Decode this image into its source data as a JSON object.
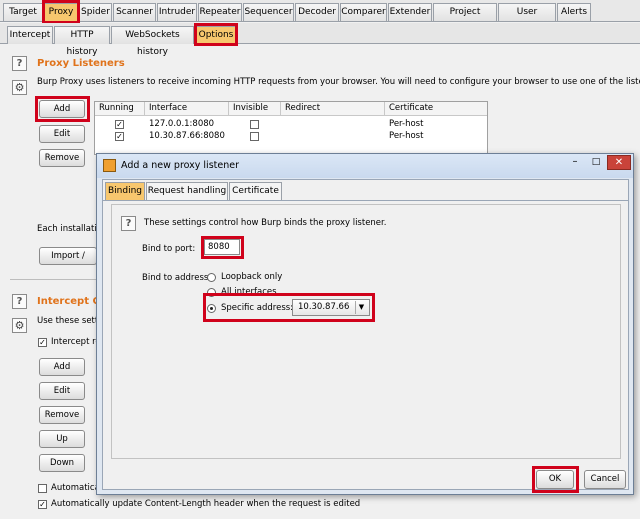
{
  "top_tabs": [
    "Target",
    "Proxy",
    "Spider",
    "Scanner",
    "Intruder",
    "Repeater",
    "Sequencer",
    "Decoder",
    "Comparer",
    "Extender",
    "Project options",
    "User options",
    "Alerts"
  ],
  "sub_tabs": [
    "Intercept",
    "HTTP history",
    "WebSockets history",
    "Options"
  ],
  "proxy_listeners": {
    "title": "Proxy Listeners",
    "description": "Burp Proxy uses listeners to receive incoming HTTP requests from your browser. You will need to configure your browser to use one of the listeners as its proxy serv",
    "buttons": {
      "add": "Add",
      "edit": "Edit",
      "remove": "Remove"
    },
    "columns": [
      "Running",
      "Interface",
      "Invisible",
      "Redirect",
      "Certificate"
    ],
    "rows": [
      {
        "running": true,
        "interface": "127.0.0.1:8080",
        "invisible": false,
        "redirect": "",
        "certificate": "Per-host"
      },
      {
        "running": true,
        "interface": "10.30.87.66:8080",
        "invisible": false,
        "redirect": "",
        "certificate": "Per-host"
      }
    ],
    "each_installation": "Each installation",
    "import_export": "Import / export"
  },
  "intercept": {
    "title": "Intercept Cli",
    "description": "Use these setting",
    "intercept_requests": "Intercept req",
    "buttons": {
      "add": "Add",
      "edit": "Edit",
      "remove": "Remove",
      "up": "Up",
      "down": "Down"
    },
    "auto_fix": "Automatically",
    "auto_update": "Automatically update Content-Length header when the request is edited"
  },
  "dialog": {
    "title": "Add a new proxy listener",
    "tabs": [
      "Binding",
      "Request handling",
      "Certificate"
    ],
    "info": "These settings control how Burp binds the proxy listener.",
    "bind_port_label": "Bind to port:",
    "bind_port_value": "8080",
    "bind_address_label": "Bind to address:",
    "loopback_only": "Loopback only",
    "all_interfaces": "All interfaces",
    "specific_address": "Specific address:",
    "specific_address_value": "10.30.87.66",
    "ok": "OK",
    "cancel": "Cancel"
  },
  "colors": {
    "accent_tab": "#f7c76e",
    "highlight": "#d0021b",
    "section_title": "#e0731b"
  }
}
